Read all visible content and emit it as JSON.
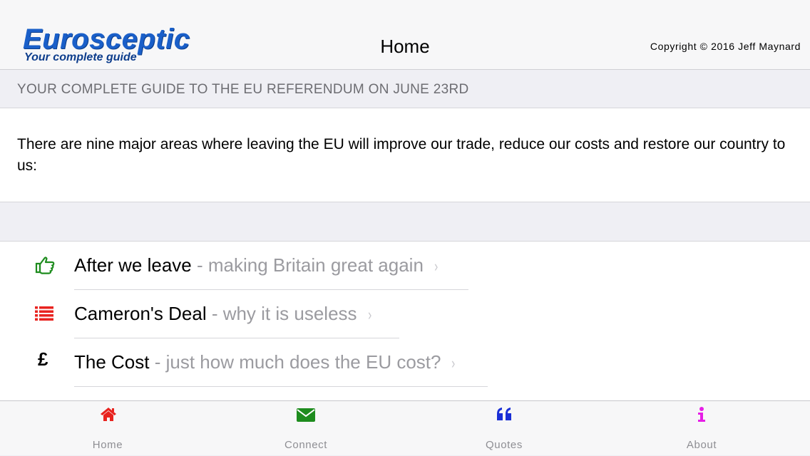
{
  "header": {
    "logo_title": "Eurosceptic",
    "logo_subtitle": "Your complete guide",
    "page_title": "Home",
    "copyright": "Copyright © 2016 Jeff Maynard"
  },
  "section": {
    "title": "YOUR COMPLETE GUIDE TO THE EU REFERENDUM ON JUNE 23RD"
  },
  "intro": {
    "text": "There are nine major areas where leaving the EU will improve our trade, reduce our costs and restore our country to us:"
  },
  "list": {
    "items": [
      {
        "icon": "thumbs-up-icon",
        "title": "After we leave",
        "subtitle": " - making Britain great again",
        "icon_color": "#1e8c1e"
      },
      {
        "icon": "list-icon",
        "title": "Cameron's Deal",
        "subtitle": " - why it is useless",
        "icon_color": "#e8231f"
      },
      {
        "icon": "pound-icon",
        "icon_text": "£",
        "title": "The Cost",
        "subtitle": " - just how much does the EU cost?",
        "icon_color": "#000000"
      }
    ],
    "chevron": "›"
  },
  "tabbar": {
    "tabs": [
      {
        "label": "Home",
        "icon": "home-icon",
        "color": "#e8231f"
      },
      {
        "label": "Connect",
        "icon": "envelope-icon",
        "color": "#1e8c1e"
      },
      {
        "label": "Quotes",
        "icon": "quote-icon",
        "color": "#1a2fd6"
      },
      {
        "label": "About",
        "icon": "info-icon",
        "color": "#e61ee6"
      }
    ]
  }
}
